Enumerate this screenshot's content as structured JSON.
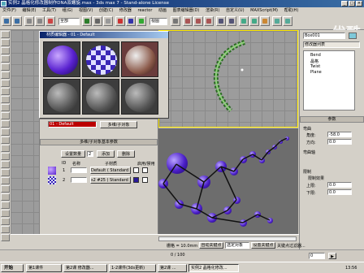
{
  "window": {
    "title": "实例2 晶格化修改器制作DNA双螺旋.max - 3ds max 7 - Stand-alone License",
    "min": "_",
    "max": "□",
    "close": "×"
  },
  "watermark": "优酷",
  "menubar": [
    "文件(F)",
    "编辑(E)",
    "工具(T)",
    "组(G)",
    "视图(V)",
    "创建(C)",
    "修改器",
    "reactor",
    "动画",
    "图表编辑器(D)",
    "渲染(R)",
    "自定义(U)",
    "MAXScript(M)",
    "帮助(H)"
  ],
  "toolbar": {
    "selection_filter": "全部",
    "view_select": "视图"
  },
  "material_editor": {
    "title": "材质编辑器 - 01 - Default",
    "menu": [
      "材质",
      "导航",
      "选项",
      "工具"
    ],
    "material_name": "01 - Default",
    "material_type": "多维/子对象",
    "basic_params_header": "多维/子对象基本参数",
    "set_count_button": "设置数量",
    "add_button": "添加",
    "delete_button": "删除",
    "col_id": "ID",
    "col_name": "名称",
    "col_submat": "子材质",
    "col_onoff": "启用/禁用",
    "count_label": "2",
    "rows": [
      {
        "id": "1",
        "name": "",
        "submat": "Default ( Standard )"
      },
      {
        "id": "2",
        "name": "",
        "submat": "s2 #25 ( Standard )"
      }
    ]
  },
  "modifier_panel": {
    "object_name": "Box001",
    "modifier_list": "修改器列表",
    "stack": [
      "Bend",
      "晶格",
      "Twist",
      "Plane"
    ],
    "params_header": "参数",
    "bend_header": "弯曲",
    "angle_label": "角度:",
    "angle_value": "-58.0",
    "direction_label": "方向:",
    "direction_value": "0.0",
    "axis_header": "弯曲轴",
    "limits_header": "限制",
    "limit_effect": "限制效果",
    "upper_label": "上限:",
    "upper_value": "0.0",
    "lower_label": "下限:",
    "lower_value": "0.0"
  },
  "status": {
    "frame": "0 / 100",
    "grid_label": "栅格 = 10.0mm",
    "auto_key": "自动关键点",
    "set_key": "设置关键点",
    "selected": "选定对象",
    "key_filter": "关键点过滤器...",
    "time": "0"
  },
  "taskbar": {
    "start": "开始",
    "items": [
      "第1课件",
      "第2课 修改器...",
      "1-2课件(3ds更新)",
      "第2课 ...",
      "实例2 晶格化修改..."
    ],
    "clock": "13:56"
  },
  "colors": {
    "titlebar": "#0a246a",
    "viewport_bg": "#9c9c9c",
    "active_border": "#ffea00",
    "ball": "#4b1fc9"
  }
}
